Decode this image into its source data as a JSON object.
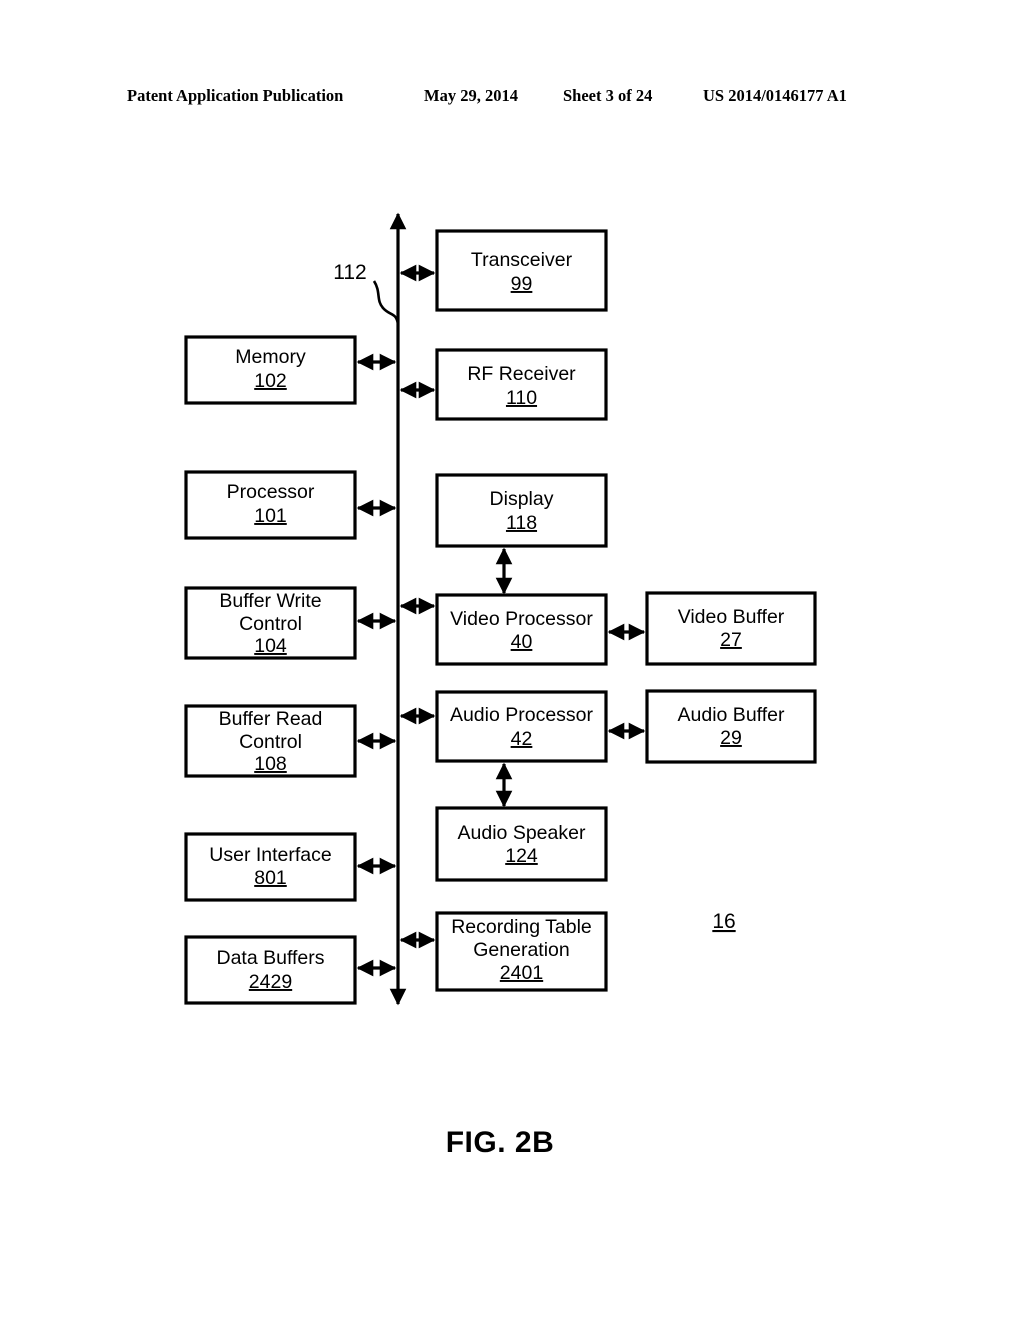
{
  "header": {
    "publication": "Patent Application Publication",
    "date": "May 29, 2014",
    "sheet": "Sheet 3 of 24",
    "patent_number": "US 2014/0146177 A1"
  },
  "figure": {
    "caption": "FIG. 2B",
    "system_ref": "16",
    "bus_ref": "112",
    "blocks": [
      {
        "id": "transceiver",
        "label": "Transceiver",
        "label2": "",
        "ref": "99"
      },
      {
        "id": "memory",
        "label": "Memory",
        "label2": "",
        "ref": "102"
      },
      {
        "id": "rf-receiver",
        "label": "RF Receiver",
        "label2": "",
        "ref": "110"
      },
      {
        "id": "processor",
        "label": "Processor",
        "label2": "",
        "ref": "101"
      },
      {
        "id": "display",
        "label": "Display",
        "label2": "",
        "ref": "118"
      },
      {
        "id": "buffer-write-control",
        "label": "Buffer Write",
        "label2": "Control",
        "ref": "104"
      },
      {
        "id": "video-processor",
        "label": "Video Processor",
        "label2": "",
        "ref": "40"
      },
      {
        "id": "video-buffer",
        "label": "Video Buffer",
        "label2": "",
        "ref": "27"
      },
      {
        "id": "buffer-read-control",
        "label": "Buffer Read",
        "label2": "Control",
        "ref": "108"
      },
      {
        "id": "audio-processor",
        "label": "Audio Processor",
        "label2": "",
        "ref": "42"
      },
      {
        "id": "audio-buffer",
        "label": "Audio Buffer",
        "label2": "",
        "ref": "29"
      },
      {
        "id": "user-interface",
        "label": "User Interface",
        "label2": "",
        "ref": "801"
      },
      {
        "id": "audio-speaker",
        "label": "Audio Speaker",
        "label2": "",
        "ref": "124"
      },
      {
        "id": "data-buffers",
        "label": "Data Buffers",
        "label2": "",
        "ref": "2429"
      },
      {
        "id": "recording-table-generation",
        "label": "Recording Table",
        "label2": "Generation",
        "ref": "2401"
      }
    ]
  },
  "colors": {
    "ink": "#000000",
    "paper": "#ffffff"
  }
}
